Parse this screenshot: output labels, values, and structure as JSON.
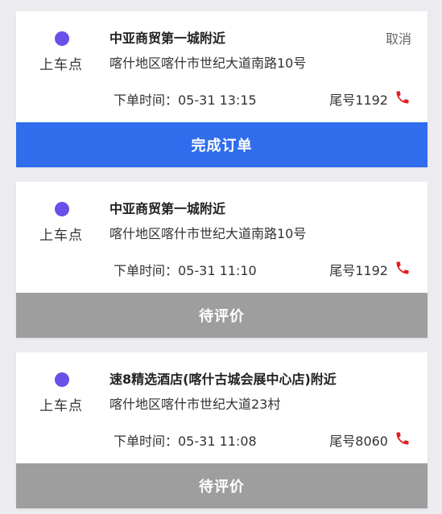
{
  "colors": {
    "background": "#ececf0",
    "dot": "#6a4fe8",
    "primary_button": "#2f6ded",
    "muted_button": "#9e9e9e",
    "phone_icon": "#e02020"
  },
  "orders": [
    {
      "pickup_label": "上车点",
      "place_name": "中亚商贸第一城附近",
      "address": "喀什地区喀什市世纪大道南路10号",
      "cancel_label": "取消",
      "order_time": "下单时间：05-31 13:15",
      "tail_number": "尾号1192",
      "phone_icon": "phone-icon",
      "action_label": "完成订单",
      "action_style": "primary"
    },
    {
      "pickup_label": "上车点",
      "place_name": "中亚商贸第一城附近",
      "address": "喀什地区喀什市世纪大道南路10号",
      "cancel_label": "",
      "order_time": "下单时间：05-31 11:10",
      "tail_number": "尾号1192",
      "phone_icon": "phone-icon",
      "action_label": "待评价",
      "action_style": "muted"
    },
    {
      "pickup_label": "上车点",
      "place_name": "速8精选酒店(喀什古城会展中心店)附近",
      "address": "喀什地区喀什市世纪大道23村",
      "cancel_label": "",
      "order_time": "下单时间：05-31 11:08",
      "tail_number": "尾号8060",
      "phone_icon": "phone-icon",
      "action_label": "待评价",
      "action_style": "muted"
    }
  ]
}
